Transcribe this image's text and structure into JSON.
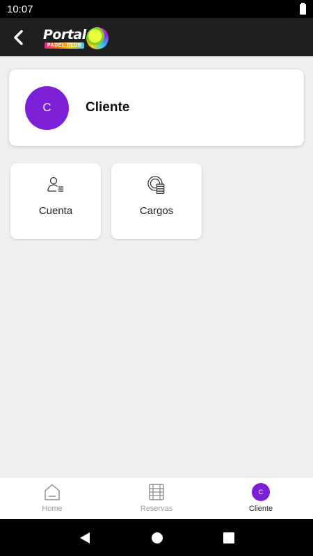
{
  "status_bar": {
    "time": "10:07"
  },
  "app_bar": {
    "logo_text": "Portal",
    "logo_subtext": "PADEL CLUB"
  },
  "client_card": {
    "avatar_initial": "C",
    "name": "Cliente"
  },
  "tiles": [
    {
      "label": "Cuenta",
      "icon": "user-list-icon"
    },
    {
      "label": "Cargos",
      "icon": "coins-icon"
    }
  ],
  "bottom_nav": {
    "items": [
      {
        "label": "Home",
        "icon": "home-icon",
        "active": false
      },
      {
        "label": "Reservas",
        "icon": "calendar-film-icon",
        "active": false
      },
      {
        "label": "Cliente",
        "icon": "avatar",
        "avatar_initial": "C",
        "active": true
      }
    ]
  },
  "colors": {
    "accent": "#7d1fd6",
    "app_bar": "#1f1f1f",
    "background": "#efefef"
  }
}
